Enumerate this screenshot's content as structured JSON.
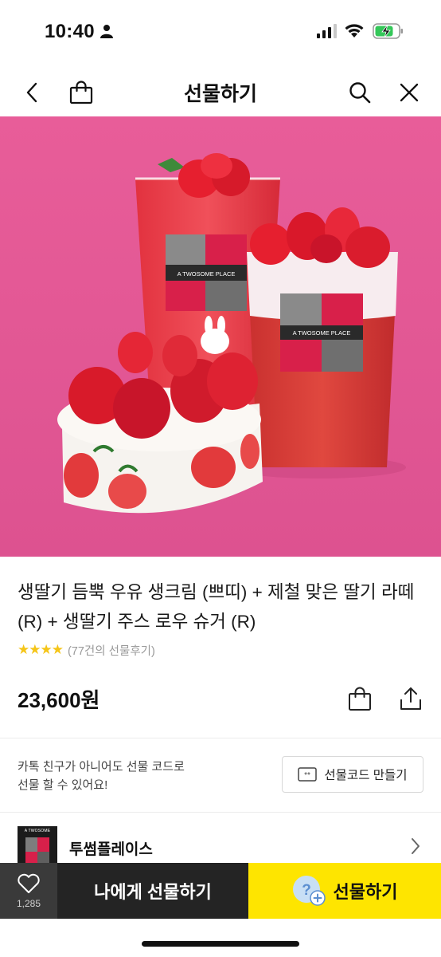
{
  "status_bar": {
    "time": "10:40"
  },
  "nav": {
    "title": "선물하기",
    "back_icon": "chevron-left-icon",
    "bag_icon": "shopping-bag-icon",
    "search_icon": "search-icon",
    "close_icon": "close-icon"
  },
  "hero": {
    "cup_label": "A TWOSOME PLACE",
    "background_color": "#e55b97"
  },
  "product": {
    "title": "생딸기 듬뿍 우유 생크림 (쁘띠) + 제철 맞은 딸기 라떼 (R) + 생딸기 주스 로우 슈거 (R)",
    "rating_stars": "★★★★",
    "rating_value": 4,
    "review_text": "(77건의 선물후기)",
    "price": "23,600원"
  },
  "gift_code": {
    "line1": "카톡 친구가 아니어도 선물 코드로",
    "line2": "선물 할 수 있어요!",
    "button_label": "선물코드 만들기"
  },
  "brand": {
    "logo_text": "A TWOSOME PLACE",
    "name": "투썸플레이스"
  },
  "bottom_bar": {
    "like_count": "1,285",
    "self_gift_label": "나에게 선물하기",
    "gift_label": "선물하기",
    "gift_color": "#fee500"
  }
}
